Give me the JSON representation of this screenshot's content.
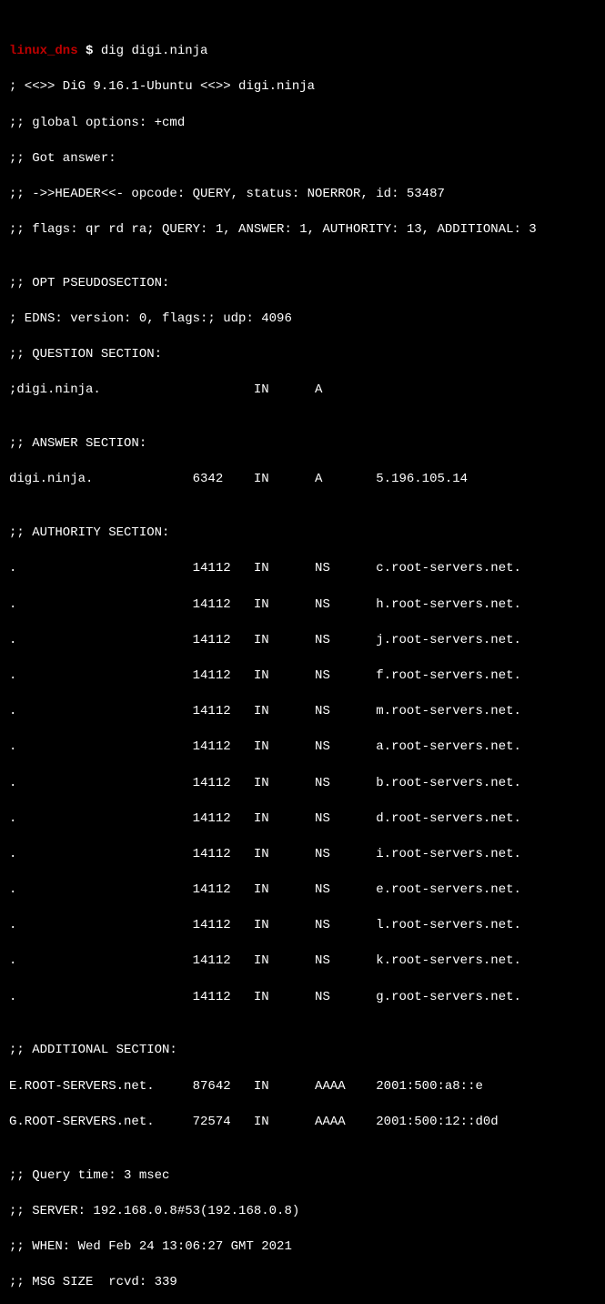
{
  "prompt": {
    "host": "linux_dns",
    "dollar": " $ ",
    "command": "dig digi.ninja"
  },
  "header": {
    "l1": "; <<>> DiG 9.16.1-Ubuntu <<>> digi.ninja",
    "l2": ";; global options: +cmd",
    "l3": ";; Got answer:",
    "l4": ";; ->>HEADER<<- opcode: QUERY, status: NOERROR, id: 53487",
    "l5": ";; flags: qr rd ra; QUERY: 1, ANSWER: 1, AUTHORITY: 13, ADDITIONAL: 3"
  },
  "opt": {
    "l1": ";; OPT PSEUDOSECTION:",
    "l2": "; EDNS: version: 0, flags:; udp: 4096",
    "l3": ";; QUESTION SECTION:",
    "l4": ";digi.ninja.                    IN      A"
  },
  "answer": {
    "title": ";; ANSWER SECTION:",
    "l1": "digi.ninja.             6342    IN      A       5.196.105.14"
  },
  "authority": {
    "title": ";; AUTHORITY SECTION:",
    "r0": ".                       14112   IN      NS      c.root-servers.net.",
    "r1": ".                       14112   IN      NS      h.root-servers.net.",
    "r2": ".                       14112   IN      NS      j.root-servers.net.",
    "r3": ".                       14112   IN      NS      f.root-servers.net.",
    "r4": ".                       14112   IN      NS      m.root-servers.net.",
    "r5": ".                       14112   IN      NS      a.root-servers.net.",
    "r6": ".                       14112   IN      NS      b.root-servers.net.",
    "r7": ".                       14112   IN      NS      d.root-servers.net.",
    "r8": ".                       14112   IN      NS      i.root-servers.net.",
    "r9": ".                       14112   IN      NS      e.root-servers.net.",
    "r10": ".                       14112   IN      NS      l.root-servers.net.",
    "r11": ".                       14112   IN      NS      k.root-servers.net.",
    "r12": ".                       14112   IN      NS      g.root-servers.net."
  },
  "additional": {
    "title": ";; ADDITIONAL SECTION:",
    "r0": "E.ROOT-SERVERS.net.     87642   IN      AAAA    2001:500:a8::e",
    "r1": "G.ROOT-SERVERS.net.     72574   IN      AAAA    2001:500:12::d0d"
  },
  "footer": {
    "l1": ";; Query time: 3 msec",
    "l2": ";; SERVER: 192.168.0.8#53(192.168.0.8)",
    "l3": ";; WHEN: Wed Feb 24 13:06:27 GMT 2021",
    "l4": ";; MSG SIZE  rcvd: 339"
  }
}
